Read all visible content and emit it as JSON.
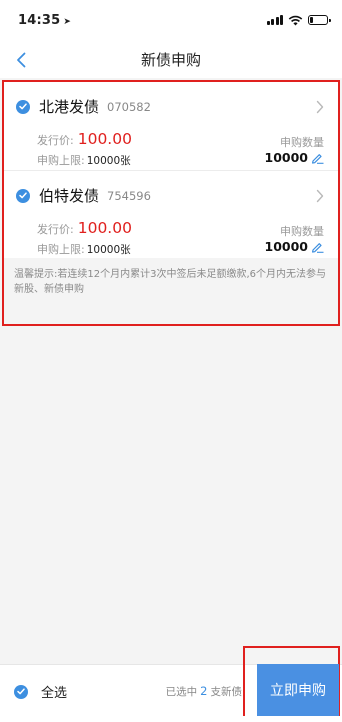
{
  "status": {
    "time": "14:35",
    "location_glyph": "➤"
  },
  "nav": {
    "title": "新债申购"
  },
  "bonds": [
    {
      "name": "北港发债",
      "code": "070582",
      "price_label": "发行价:",
      "price": "100.00",
      "limit_label": "申购上限:",
      "limit_value": "10000张",
      "qty_label": "申购数量",
      "qty": "10000"
    },
    {
      "name": "伯特发债",
      "code": "754596",
      "price_label": "发行价:",
      "price": "100.00",
      "limit_label": "申购上限:",
      "limit_value": "10000张",
      "qty_label": "申购数量",
      "qty": "10000"
    }
  ],
  "notice": "温馨提示:若连续12个月内累计3次中签后未足额缴款,6个月内无法参与新股、新债申购",
  "footer": {
    "select_all_label": "全选",
    "selected_prefix": "已选中",
    "selected_count": "2",
    "selected_suffix": "支新债",
    "submit_label": "立即申购"
  },
  "colors": {
    "accent_blue": "#4a90e2",
    "price_red": "#e0201e",
    "highlight_red": "#e0201e"
  }
}
